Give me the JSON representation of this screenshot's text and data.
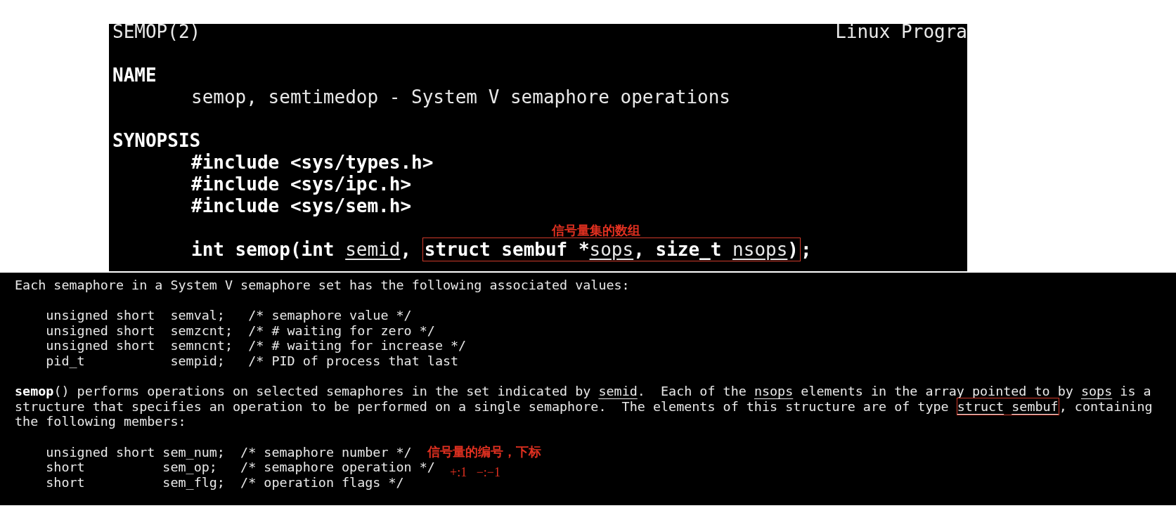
{
  "top_panel": {
    "header_left": "SEMOP(2)",
    "header_right": "Linux Progra",
    "sections": [
      {
        "heading": "NAME",
        "paragraphs": [
          [
            {
              "segments": [
                {
                  "kind": "plain",
                  "text": "semop, semtimedop - System V semaphore operations"
                }
              ]
            }
          ]
        ]
      },
      {
        "heading": "SYNOPSIS",
        "paragraphs": [
          [
            {
              "segments": [
                {
                  "kind": "bold",
                  "text": "#include <sys/types.h>"
                }
              ]
            },
            {
              "segments": [
                {
                  "kind": "bold",
                  "text": "#include <sys/ipc.h>"
                }
              ]
            },
            {
              "segments": [
                {
                  "kind": "bold",
                  "text": "#include <sys/sem.h>"
                }
              ]
            }
          ],
          [
            {
              "note": {
                "kind": "above",
                "text": "信号量集的数组"
              },
              "segments": [
                {
                  "kind": "bold",
                  "text": "int semop(int "
                },
                {
                  "kind": "underline",
                  "text": "semid"
                },
                {
                  "kind": "bold",
                  "text": ", "
                },
                {
                  "kind": "box",
                  "segments": [
                    {
                      "kind": "bold",
                      "text": "struct sembuf *"
                    },
                    {
                      "kind": "underline",
                      "text": "sops"
                    },
                    {
                      "kind": "bold",
                      "text": ", size_t "
                    },
                    {
                      "kind": "underline",
                      "text": "nsops"
                    },
                    {
                      "kind": "bold",
                      "text": ")"
                    }
                  ]
                },
                {
                  "kind": "bold",
                  "text": ";"
                }
              ]
            }
          ]
        ]
      }
    ]
  },
  "bottom_panel": {
    "paragraphs": [
      [
        {
          "segments": [
            {
              "kind": "plain",
              "text": "Each semaphore in a System V semaphore set has the following associated values:"
            }
          ]
        }
      ],
      [
        {
          "segments": [
            {
              "kind": "plain",
              "text": "    unsigned short  semval;   /* semaphore value */"
            }
          ]
        },
        {
          "segments": [
            {
              "kind": "plain",
              "text": "    unsigned short  semzcnt;  /* # waiting for zero */"
            }
          ]
        },
        {
          "segments": [
            {
              "kind": "plain",
              "text": "    unsigned short  semncnt;  /* # waiting for increase */"
            }
          ]
        },
        {
          "segments": [
            {
              "kind": "plain",
              "text": "    pid_t           sempid;   /* PID of process that last"
            }
          ]
        }
      ],
      [
        {
          "segments": [
            {
              "kind": "bold",
              "text": "semop"
            },
            {
              "kind": "plain",
              "text": "() performs operations on selected semaphores in the set indicated by "
            },
            {
              "kind": "underline",
              "text": "semid"
            },
            {
              "kind": "plain",
              "text": ".  Each of the "
            },
            {
              "kind": "underline",
              "text": "nsops"
            },
            {
              "kind": "plain",
              "text": " elements in the array pointed to by "
            },
            {
              "kind": "underline",
              "text": "sops"
            },
            {
              "kind": "plain",
              "text": " is a"
            }
          ]
        },
        {
          "segments": [
            {
              "kind": "plain",
              "text": "structure that specifies an operation to be performed on a single semaphore.  The elements of this structure are of type "
            },
            {
              "kind": "box",
              "segments": [
                {
                  "kind": "underline",
                  "text": "struct sembuf"
                }
              ]
            },
            {
              "kind": "plain",
              "text": ", containing"
            }
          ]
        },
        {
          "segments": [
            {
              "kind": "plain",
              "text": "the following members:"
            }
          ]
        }
      ],
      [
        {
          "note": {
            "kind": "beside",
            "text": "信号量的编号，下标"
          },
          "segments": [
            {
              "kind": "plain",
              "text": "    unsigned short sem_num;  /* semaphore number */"
            }
          ]
        },
        {
          "note": {
            "kind": "below",
            "text": "+:1   −:−1"
          },
          "segments": [
            {
              "kind": "plain",
              "text": "    short          sem_op;   /* semaphore operation */"
            }
          ]
        },
        {
          "segments": [
            {
              "kind": "plain",
              "text": "    short          sem_flg;  /* operation flags */"
            }
          ]
        }
      ]
    ]
  }
}
